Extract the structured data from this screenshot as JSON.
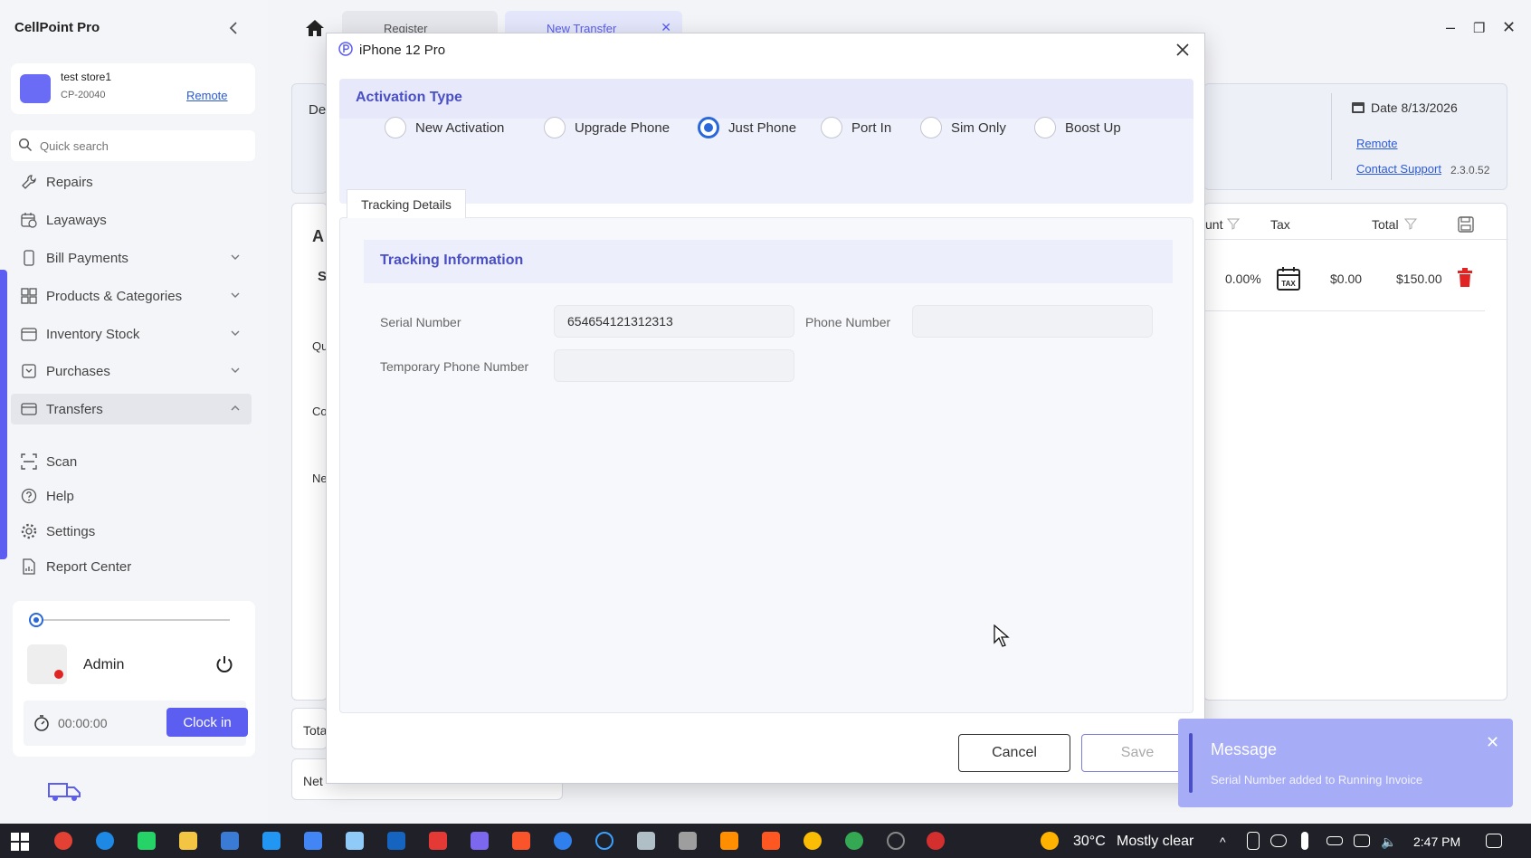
{
  "sidebar": {
    "brand": "CellPoint Pro",
    "store": {
      "name": "test store1",
      "code": "CP-20040",
      "remote_label": "Remote"
    },
    "search": {
      "placeholder": "Quick search"
    },
    "items": [
      {
        "label": "Repairs"
      },
      {
        "label": "Layaways"
      },
      {
        "label": "Bill Payments"
      },
      {
        "label": "Products & Categories"
      },
      {
        "label": "Inventory Stock"
      },
      {
        "label": "Purchases"
      },
      {
        "label": "Transfers"
      },
      {
        "label": "Scan"
      },
      {
        "label": "Help"
      },
      {
        "label": "Settings"
      },
      {
        "label": "Report Center"
      }
    ],
    "user": {
      "name": "Admin",
      "timer": "00:00:00",
      "clock_in_label": "Clock in"
    }
  },
  "tabs": [
    {
      "label": "Register"
    },
    {
      "label": "New Transfer"
    }
  ],
  "background": {
    "left_fragments": [
      "De",
      "A",
      "S",
      "Qu",
      "Co",
      "Ne",
      "Tota",
      "Net"
    ],
    "date_label": "Date 8/13/2026",
    "remote_label": "Remote",
    "contact_support_label": "Contact Support",
    "version": "2.3.0.52",
    "table": {
      "headers": [
        "unt",
        "Tax",
        "Total"
      ],
      "row": {
        "discount": "0.00%",
        "tax": "$0.00",
        "total": "$150.00"
      }
    }
  },
  "modal": {
    "title": "iPhone 12 Pro",
    "activation_type_title": "Activation Type",
    "activation_options": [
      {
        "label": "New Activation",
        "checked": false
      },
      {
        "label": "Upgrade Phone",
        "checked": false
      },
      {
        "label": "Just Phone",
        "checked": true
      },
      {
        "label": "Port In",
        "checked": false
      },
      {
        "label": "Sim Only",
        "checked": false
      },
      {
        "label": "Boost Up",
        "checked": false
      }
    ],
    "tab_label": "Tracking Details",
    "section_title": "Tracking Information",
    "fields": {
      "serial_label": "Serial Number",
      "serial_value": "654654121312313",
      "phone_label": "Phone Number",
      "phone_value": "",
      "temp_phone_label": "Temporary Phone Number",
      "temp_phone_value": ""
    },
    "cancel_label": "Cancel",
    "save_label": "Save"
  },
  "toast": {
    "title": "Message",
    "text": "Serial Number added to Running Invoice"
  },
  "taskbar": {
    "weather": "30°C",
    "weather_text": "Mostly clear",
    "time": "2:47 PM"
  },
  "colors": {
    "accent": "#5b5ef0",
    "heading": "#4a4fc4",
    "radio_checked": "#2a67d8",
    "toast_bg": "#a6acf5",
    "danger": "#e02424"
  }
}
